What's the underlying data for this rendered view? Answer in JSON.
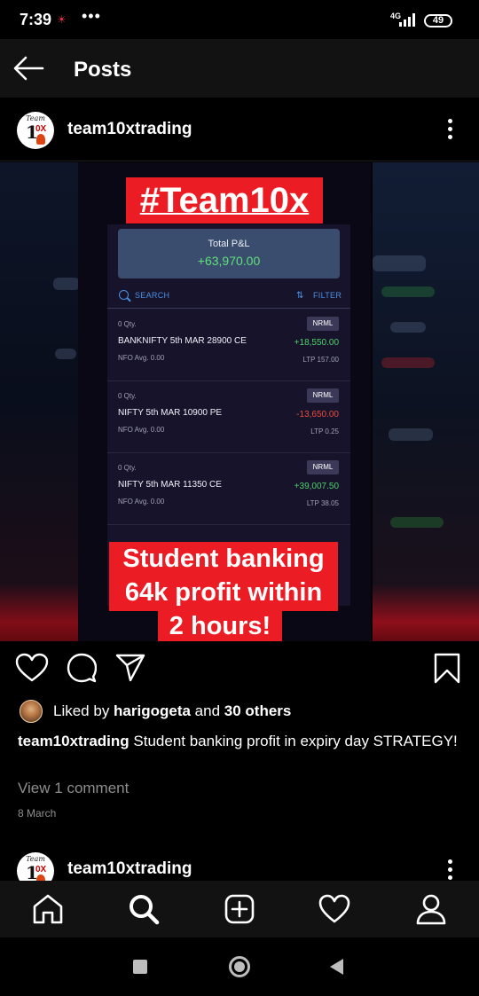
{
  "status_bar": {
    "time": "7:39",
    "notification": "☀",
    "more": "•••",
    "network": "4G",
    "battery": "49"
  },
  "topbar": {
    "title": "Posts"
  },
  "post": {
    "username": "team10xtrading",
    "image": {
      "hashtag": "#Team10x",
      "pnl": {
        "label": "Total P&L",
        "value": "+63,970.00"
      },
      "search_label": "SEARCH",
      "filter_label": "FILTER",
      "positions": [
        {
          "qty": "0 Qty.",
          "badge": "NRML",
          "name": "BANKNIFTY 5th  MAR 28900 CE",
          "pnl": "+18,550.00",
          "sign": "pos",
          "sub": "NFO  Avg. 0.00",
          "ltp": "LTP 157.00"
        },
        {
          "qty": "0 Qty.",
          "badge": "NRML",
          "name": "NIFTY 5th  MAR 10900 PE",
          "pnl": "-13,650.00",
          "sign": "neg",
          "sub": "NFO  Avg. 0.00",
          "ltp": "LTP 0.25"
        },
        {
          "qty": "0 Qty.",
          "badge": "NRML",
          "name": "NIFTY 5th  MAR 11350 CE",
          "pnl": "+39,007.50",
          "sign": "pos",
          "sub": "NFO  Avg. 0.00",
          "ltp": "LTP 38.05"
        }
      ],
      "caption_lines": [
        "Student banking",
        "64k profit within",
        "2 hours!"
      ]
    },
    "likes": {
      "prefix": "Liked by ",
      "user": "harigogeta",
      "middle": " and ",
      "others": "30 others"
    },
    "caption": {
      "user": "team10xtrading",
      "text": " Student banking profit in expiry day STRATEGY!"
    },
    "view_comments": "View 1 comment",
    "date": "8 March"
  },
  "next_post": {
    "username": "team10xtrading"
  },
  "icons": {
    "back": "back-arrow-icon",
    "more": "more-vertical-icon",
    "like": "heart-icon",
    "comment": "comment-icon",
    "share": "send-icon",
    "save": "bookmark-icon",
    "home": "home-icon",
    "search": "search-icon",
    "add": "add-post-icon",
    "activity": "heart-icon",
    "profile": "profile-icon"
  },
  "colors": {
    "accent_red": "#ec1c24",
    "profit_green": "#4cd26a",
    "loss_red": "#e84c3c",
    "link_blue": "#4a90e2"
  }
}
